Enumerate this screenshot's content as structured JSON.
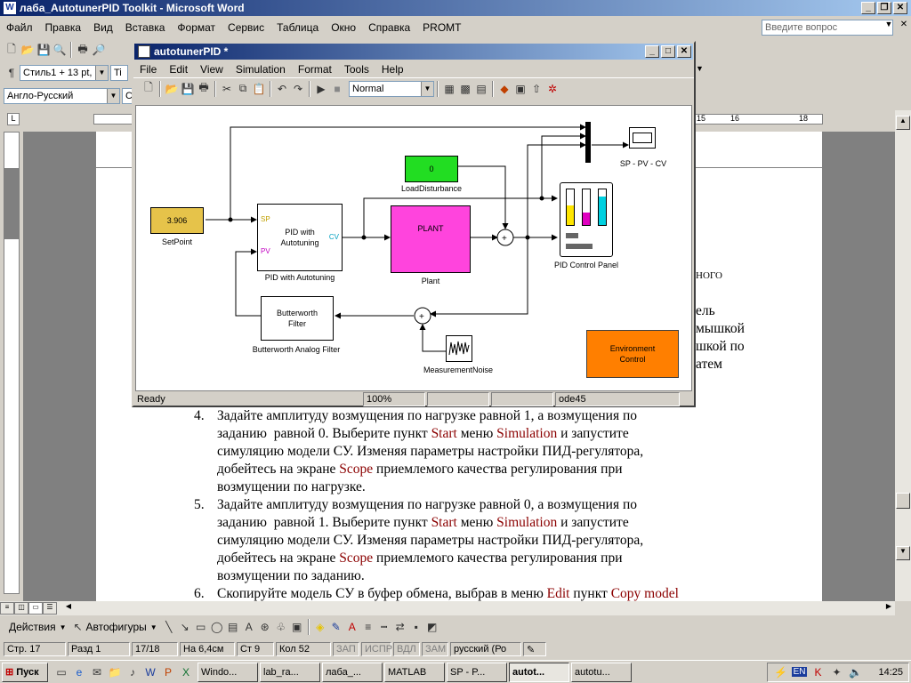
{
  "word": {
    "title": "лаба_AutotunerPID Toolkit - Microsoft Word",
    "menu": [
      "Файл",
      "Правка",
      "Вид",
      "Вставка",
      "Формат",
      "Сервис",
      "Таблица",
      "Окно",
      "Справка",
      "PROMT"
    ],
    "help_placeholder": "Введите вопрос",
    "style_combo": "Стиль1 + 13 pt,",
    "font_combo": "Ti",
    "lang_combo": "Англо-Русский",
    "ruler_marks": [
      "15",
      "16",
      "18"
    ],
    "right_fragments": [
      "НОГО",
      "ель",
      "мышкой",
      "шкой по",
      "атем"
    ],
    "doc_items": [
      {
        "num": "4.",
        "lines": [
          [
            {
              "t": "Задайте амплитуду возмущения по нагрузке равной 1, а возмущения по"
            }
          ],
          [
            {
              "t": "заданию  равной 0. Выберите пункт "
            },
            {
              "t": "Start",
              "r": 1
            },
            {
              "t": " меню "
            },
            {
              "t": "Simulation",
              "r": 1
            },
            {
              "t": " и запустите"
            }
          ],
          [
            {
              "t": "симуляцию модели СУ. Изменяя параметры настройки ПИД-регулятора,"
            }
          ],
          [
            {
              "t": "добейтесь на экране "
            },
            {
              "t": "Scope",
              "r": 1
            },
            {
              "t": " приемлемого качества регулирования при"
            }
          ],
          [
            {
              "t": "возмущении по нагрузке."
            }
          ]
        ]
      },
      {
        "num": "5.",
        "lines": [
          [
            {
              "t": "Задайте амплитуду возмущения по нагрузке равной 0, а возмущения по"
            }
          ],
          [
            {
              "t": "заданию  равной 1. Выберите пункт "
            },
            {
              "t": "Start",
              "r": 1
            },
            {
              "t": " меню "
            },
            {
              "t": "Simulation",
              "r": 1
            },
            {
              "t": " и запустите"
            }
          ],
          [
            {
              "t": "симуляцию модели СУ. Изменяя параметры настройки ПИД-регулятора,"
            }
          ],
          [
            {
              "t": "добейтесь на экране "
            },
            {
              "t": "Scope",
              "r": 1
            },
            {
              "t": " приемлемого качества регулирования при"
            }
          ],
          [
            {
              "t": "возмущении по заданию."
            }
          ]
        ]
      },
      {
        "num": "6.",
        "lines": [
          [
            {
              "t": "Скопируйте модель СУ в буфер обмена, выбрав в меню "
            },
            {
              "t": "Edit",
              "r": 1
            },
            {
              "t": " пункт "
            },
            {
              "t": "Copy model",
              "r": 1
            }
          ]
        ]
      }
    ],
    "drawing_toolbar": {
      "actions": "Действия",
      "autoshapes": "Автофигуры"
    },
    "status": {
      "page": "Стр. 17",
      "section": "Разд 1",
      "pages": "17/18",
      "at": "На 6,4см",
      "line": "Ст 9",
      "col": "Кол 52",
      "rec": "ЗАП",
      "trk": "ИСПР",
      "ext": "ВДЛ",
      "ovr": "ЗАМ",
      "lang": "русский (Ро"
    }
  },
  "simulink": {
    "title": "autotunerPID *",
    "menu": [
      "File",
      "Edit",
      "View",
      "Simulation",
      "Format",
      "Tools",
      "Help"
    ],
    "sim_mode": "Normal",
    "blocks": {
      "setpoint_value": "3.906",
      "setpoint_label": "SetPoint",
      "pid_text": "PID with Autotuning",
      "pid_sp": "SP",
      "pid_pv": "PV",
      "pid_cv": "CV",
      "pid_label": "PID with Autotuning",
      "load_value": "0",
      "load_label": "LoadDisturbance",
      "plant_text": "PLANT",
      "plant_label": "Plant",
      "panel_label": "PID Control Panel",
      "scope_label": "SP - PV - CV",
      "filter_text": "Butterworth Filter",
      "filter_label": "Butterworth Analog Filter",
      "noise_label": "MeasurementNoise",
      "env_text": "Environment Control"
    },
    "status": {
      "ready": "Ready",
      "zoom": "100%",
      "solver": "ode45"
    }
  },
  "taskbar": {
    "start": "Пуск",
    "buttons": [
      "Windo...",
      "lab_ra...",
      "лаба_...",
      "MATLAB",
      "SP - P...",
      "autot...",
      "autotu..."
    ],
    "active_index": 5,
    "tray_lang": "EN",
    "clock": "14:25"
  },
  "colors": {
    "setpoint": "#e6c34a",
    "load": "#22dd22",
    "plant": "#ff44dd",
    "env": "#ff7f00",
    "title_blue": "#0a246a"
  }
}
